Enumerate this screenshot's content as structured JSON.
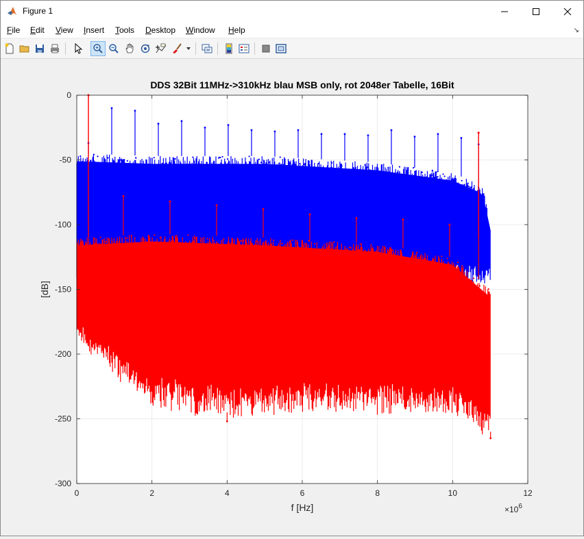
{
  "window": {
    "title": "Figure 1"
  },
  "menu": [
    {
      "label": "File",
      "key": "F",
      "rest": "ile"
    },
    {
      "label": "Edit",
      "key": "E",
      "rest": "dit"
    },
    {
      "label": "View",
      "key": "V",
      "rest": "iew"
    },
    {
      "label": "Insert",
      "key": "I",
      "rest": "nsert"
    },
    {
      "label": "Tools",
      "key": "T",
      "rest": "ools"
    },
    {
      "label": "Desktop",
      "key": "D",
      "rest": "esktop"
    },
    {
      "label": "Window",
      "key": "W",
      "rest": "indow"
    },
    {
      "label": "Help",
      "key": "H",
      "rest": "elp"
    }
  ],
  "toolbar": {
    "icons": [
      "new-figure-icon",
      "open-file-icon",
      "save-icon",
      "print-icon",
      "pointer-icon",
      "zoom-in-icon",
      "zoom-out-icon",
      "pan-icon",
      "rotate-3d-icon",
      "data-cursor-icon",
      "brush-icon",
      "link-plot-icon",
      "colorbar-icon",
      "legend-icon",
      "hide-plot-tools-icon",
      "show-plot-tools-icon"
    ],
    "active": "zoom-in-icon"
  },
  "colors": {
    "blue_series": "#0000ff",
    "red_series": "#ff0000",
    "grid": "#e6e6e6",
    "axes": "#262626"
  },
  "chart_data": {
    "type": "line",
    "title": "DDS 32Bit 11MHz->310kHz blau MSB only, rot 2048er Tabelle, 16Bit",
    "xlabel": "f [Hz]",
    "ylabel": "[dB]",
    "xlim": [
      0,
      12000000
    ],
    "ylim": [
      -300,
      0
    ],
    "x_exponent_label": "×10",
    "x_exponent_power": "6",
    "x_ticks": [
      0,
      2000000,
      4000000,
      6000000,
      8000000,
      10000000,
      12000000
    ],
    "x_tick_labels": [
      "0",
      "2",
      "4",
      "6",
      "8",
      "10",
      "12"
    ],
    "y_ticks": [
      0,
      -50,
      -100,
      -150,
      -200,
      -250,
      -300
    ],
    "y_tick_labels": [
      "0",
      "-50",
      "-100",
      "-150",
      "-200",
      "-250",
      "-300"
    ],
    "grid": true,
    "series": [
      {
        "color": "#0000ff",
        "description": "dense spectrum band",
        "x_range": [
          0,
          11000000
        ],
        "band_top": [
          [
            0,
            -45
          ],
          [
            2000000,
            -47
          ],
          [
            5000000,
            -47
          ],
          [
            8000000,
            -52
          ],
          [
            10000000,
            -60
          ],
          [
            10800000,
            -70
          ],
          [
            11000000,
            -97
          ]
        ],
        "band_bottom": [
          [
            0,
            -140
          ],
          [
            11000000,
            -140
          ]
        ],
        "spurs": [
          [
            310000,
            -37
          ],
          [
            930000,
            -10
          ],
          [
            1550000,
            -12
          ],
          [
            2170000,
            -22
          ],
          [
            2790000,
            -20
          ],
          [
            3410000,
            -25
          ],
          [
            4030000,
            -23
          ],
          [
            4650000,
            -27
          ],
          [
            5270000,
            -28
          ],
          [
            5890000,
            -27
          ],
          [
            6510000,
            -30
          ],
          [
            7130000,
            -30
          ],
          [
            7750000,
            -31
          ],
          [
            8370000,
            -27
          ],
          [
            8990000,
            -32
          ],
          [
            9610000,
            -30
          ],
          [
            10230000,
            -33
          ],
          [
            10690000,
            -38
          ]
        ]
      },
      {
        "color": "#ff0000",
        "description": "dense spectrum band",
        "x_range": [
          0,
          11000000
        ],
        "band_top": [
          [
            0,
            -110
          ],
          [
            2000000,
            -107
          ],
          [
            5000000,
            -110
          ],
          [
            8000000,
            -115
          ],
          [
            10000000,
            -125
          ],
          [
            11000000,
            -150
          ]
        ],
        "band_bottom": [
          [
            0,
            -185
          ],
          [
            2000000,
            -235
          ],
          [
            4000000,
            -245
          ],
          [
            6000000,
            -240
          ],
          [
            8000000,
            -240
          ],
          [
            10000000,
            -240
          ],
          [
            11000000,
            -260
          ]
        ],
        "spurs": [
          [
            310000,
            0
          ],
          [
            10690000,
            -29
          ],
          [
            1240000,
            -78
          ],
          [
            2480000,
            -82
          ],
          [
            3720000,
            -85
          ],
          [
            4960000,
            -88
          ],
          [
            6200000,
            -92
          ],
          [
            7440000,
            -95
          ],
          [
            8680000,
            -96
          ],
          [
            9920000,
            -100
          ]
        ],
        "dips": [
          [
            4000000,
            -252
          ],
          [
            11010000,
            -265
          ]
        ]
      }
    ]
  }
}
